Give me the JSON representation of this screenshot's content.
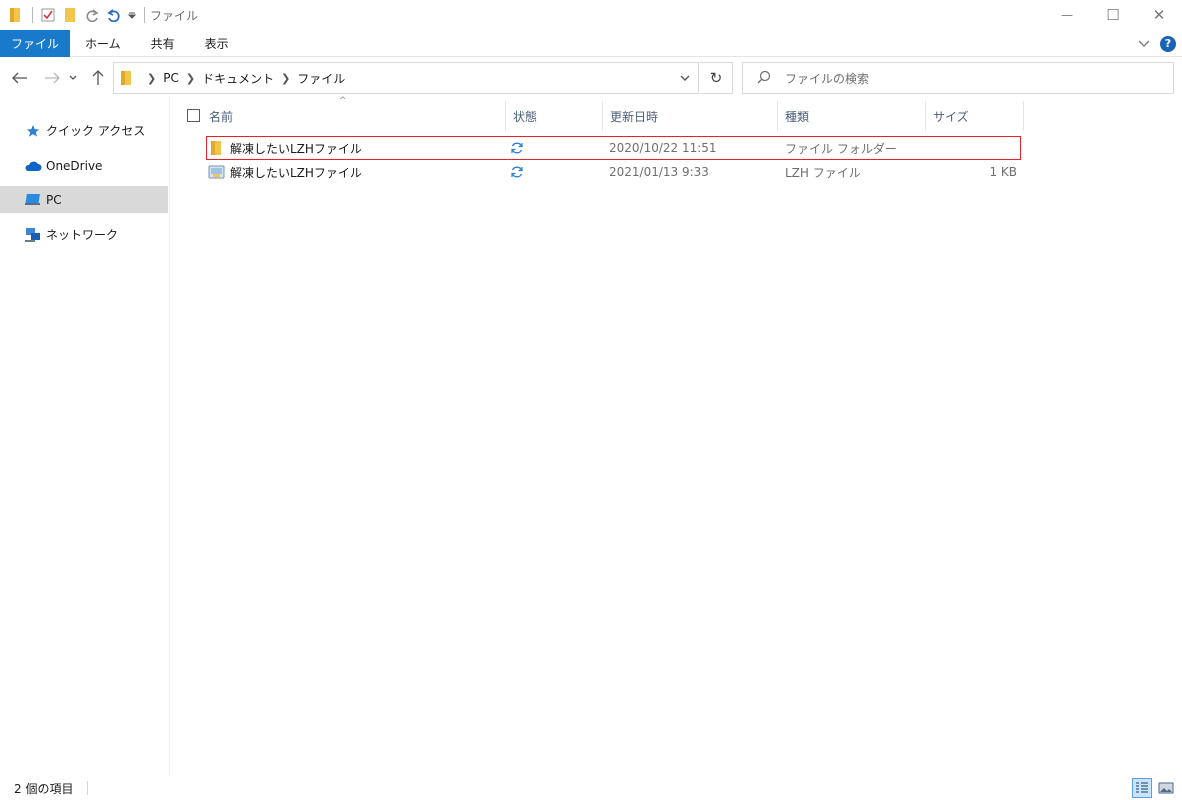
{
  "window": {
    "title": "ファイル",
    "controls": {
      "minimize": "—",
      "maximize": "☐",
      "close": "✕"
    }
  },
  "ribbon": {
    "tabs": [
      {
        "label": "ファイル",
        "active": true
      },
      {
        "label": "ホーム"
      },
      {
        "label": "共有"
      },
      {
        "label": "表示"
      }
    ],
    "help": "?"
  },
  "address": {
    "breadcrumbs": [
      "PC",
      "ドキュメント",
      "ファイル"
    ],
    "search_placeholder": "ファイルの検索"
  },
  "nav": {
    "items": [
      {
        "label": "クイック アクセス",
        "icon": "star-icon"
      },
      {
        "label": "OneDrive",
        "icon": "cloud-icon"
      },
      {
        "label": "PC",
        "icon": "computer-icon",
        "selected": true
      },
      {
        "label": "ネットワーク",
        "icon": "network-icon"
      }
    ]
  },
  "list": {
    "sort_indicator": "^",
    "columns": {
      "name": "名前",
      "status": "状態",
      "modified": "更新日時",
      "type": "種類",
      "size": "サイズ"
    },
    "rows": [
      {
        "name": "解凍したいLZHファイル",
        "icon": "folder-icon",
        "status_icon": "sync-icon",
        "modified": "2020/10/22 11:51",
        "type": "ファイル フォルダー",
        "size": "",
        "highlighted": true
      },
      {
        "name": "解凍したいLZHファイル",
        "icon": "archive-file-icon",
        "status_icon": "sync-icon",
        "modified": "2021/01/13 9:33",
        "type": "LZH ファイル",
        "size": "1 KB",
        "highlighted": false
      }
    ]
  },
  "statusbar": {
    "item_count": "2 個の項目"
  },
  "colors": {
    "accent": "#1979ca",
    "folder": "#f3c54a",
    "highlight_border": "#e0242a",
    "sync": "#2b7cd3",
    "header_text": "#4c607a"
  }
}
